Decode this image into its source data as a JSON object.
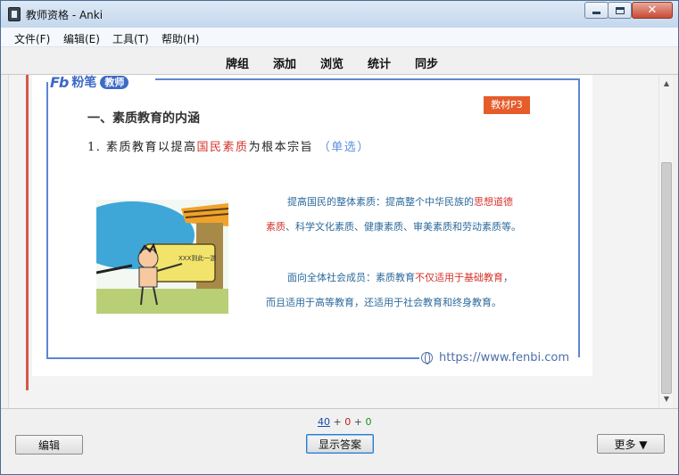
{
  "window": {
    "title": "教师资格 - Anki",
    "close_glyph": "✕"
  },
  "menu": [
    "文件(F)",
    "编辑(E)",
    "工具(T)",
    "帮助(H)"
  ],
  "toolbar": [
    "牌组",
    "添加",
    "浏览",
    "统计",
    "同步"
  ],
  "card": {
    "logo": {
      "fb": "Fb",
      "name": "粉笔",
      "badge": "教师"
    },
    "tag": "教材P3",
    "heading": "一、素质教育的内涵",
    "point1": {
      "prefix": "1. 素质教育以提高",
      "highlight": "国民素质",
      "middle": "为根本宗旨",
      "hint": "（单选）"
    },
    "para1_line1": {
      "text": "提高国民的整体素质：提高整个中华民族的",
      "highlight": "思想道德"
    },
    "para1_line2": {
      "highlight": "素质",
      "text": "、科学文化素质、健康素质、审美素质和劳动素质等。"
    },
    "para2_line1": {
      "text": "面向全体社会成员：素质教育",
      "highlight": "不仅适用于基础教育",
      "suffix": "，"
    },
    "para2_line2": {
      "text": "而且适用于高等教育，还适用于社会教育和终身教育。"
    },
    "illustration_sign": "XXX到此一游",
    "url": "https://www.fenbi.com"
  },
  "scroll": {
    "up_glyph": "▲",
    "down_glyph": "▼"
  },
  "counts": {
    "new": "40",
    "sep": " + ",
    "learn": "0",
    "review": "0"
  },
  "buttons": {
    "edit": "编辑",
    "show_answer": "显示答案",
    "more": "更多 ▼"
  },
  "colors": {
    "accent_red": "#d5342c",
    "link_blue": "#5b8ee0",
    "frame_blue": "#5d87d1",
    "tag_orange": "#e65c2b"
  }
}
